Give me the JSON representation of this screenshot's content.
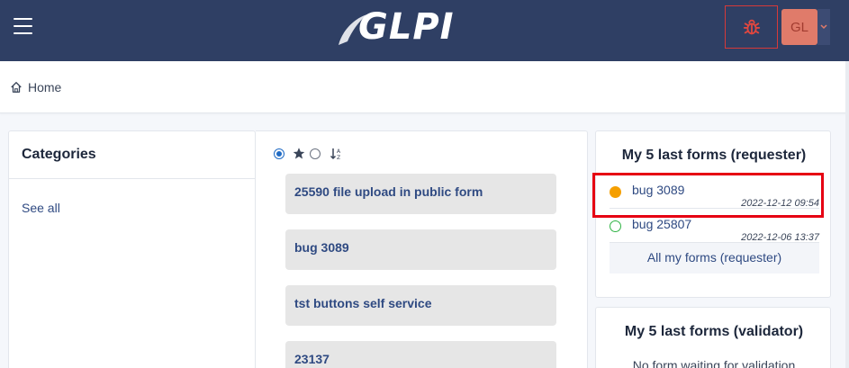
{
  "header": {
    "logo_text": "GLPI",
    "avatar_initials": "GL",
    "colors": {
      "topbar": "#2f3f64",
      "debug_border": "#d63939",
      "avatar_bg": "#e07b6a"
    }
  },
  "breadcrumb": {
    "home_label": "Home"
  },
  "categories": {
    "title": "Categories",
    "see_all": "See all"
  },
  "forms": {
    "cards": [
      {
        "label": "25590 file upload in public form"
      },
      {
        "label": "bug 3089"
      },
      {
        "label": "tst buttons self service"
      },
      {
        "label": "23137"
      }
    ]
  },
  "requester": {
    "title": "My 5 last forms (requester)",
    "items": [
      {
        "name": "bug 3089",
        "date": "2022-12-12 09:54",
        "status": "in-progress",
        "status_color": "#f59f00"
      },
      {
        "name": "bug 25807",
        "date": "2022-12-06 13:37",
        "status": "new",
        "status_color": "#2fb344"
      }
    ],
    "all_link": "All my forms (requester)"
  },
  "validator": {
    "title": "My 5 last forms (validator)",
    "empty_text": "No form waiting for validation"
  }
}
